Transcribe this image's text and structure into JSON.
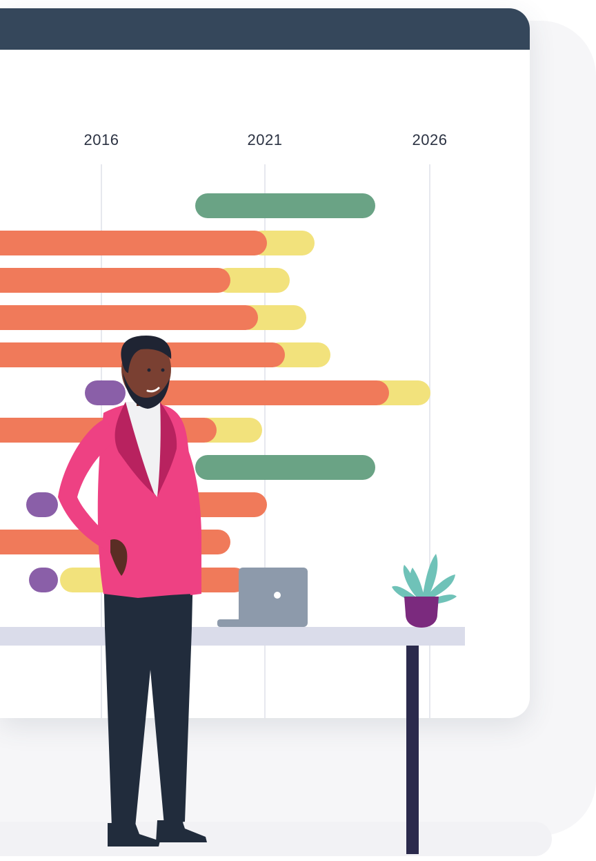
{
  "timeline": {
    "years": [
      "2016",
      "2021",
      "2026"
    ]
  },
  "colors": {
    "window_bar": "#35475b",
    "bar_orange": "#f07a5a",
    "bar_yellow": "#f2e27c",
    "bar_green": "#6aa385",
    "bar_purple": "#8a5fa8",
    "desk_top": "#dadcea",
    "desk_leg": "#2b2a4c",
    "laptop": "#8d9aab",
    "plant_pot": "#7b2a7e",
    "plant_leaves": "#6fc2b8",
    "jacket": "#ee4183",
    "trousers": "#212c3c"
  },
  "illustration": {
    "subject": "person-standing-at-desk",
    "objects": [
      "laptop",
      "potted-plant",
      "desk"
    ]
  }
}
